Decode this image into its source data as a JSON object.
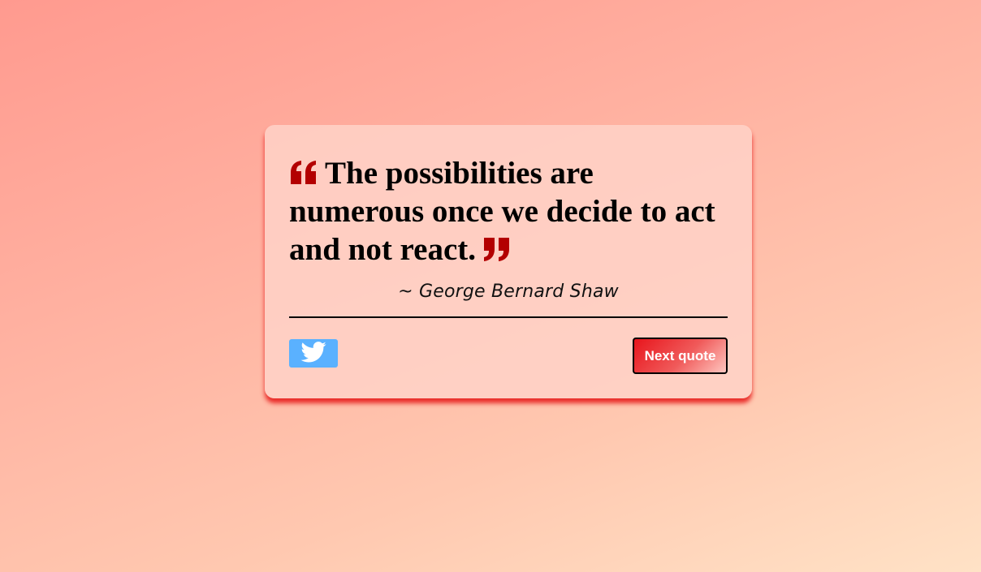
{
  "quote": {
    "text": "The possibilities are numerous once we decide to act and not react.",
    "author": "~ George Bernard Shaw",
    "open_icon": "quote-left-icon",
    "close_icon": "quote-right-icon"
  },
  "actions": {
    "tweet_icon": "twitter-icon",
    "next_label": "Next quote"
  },
  "colors": {
    "quote_mark": "#b30000",
    "twitter_button": "#5ab1ff",
    "card_shadow": "#e61414"
  }
}
